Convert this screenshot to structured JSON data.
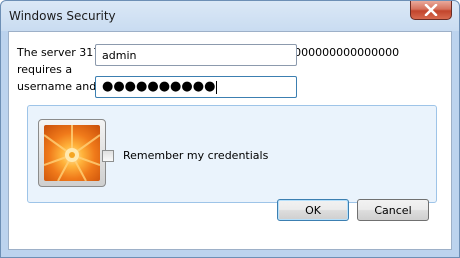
{
  "window": {
    "title": "Windows Security",
    "close_glyph": "X"
  },
  "dialog": {
    "message_line1": "The server 3170-1 at Digest:BFE40000000000000000000000000000 requires a",
    "message_line2": "username and password."
  },
  "form": {
    "username_value": "admin",
    "password_masked": "●●●●●●●●●●",
    "remember_label": "Remember my credentials",
    "remember_checked": false
  },
  "buttons": {
    "ok_label": "OK",
    "cancel_label": "Cancel"
  },
  "icons": {
    "avatar": "user-avatar-flower-icon",
    "close": "close-icon"
  },
  "colors": {
    "close_button": "#c2452c",
    "panel_background": "#eaf3fc",
    "window_chrome": "#c9dcf1"
  }
}
